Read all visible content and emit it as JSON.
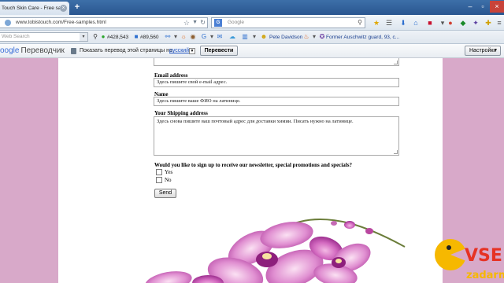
{
  "browser": {
    "tab_title": "Touch Skin Care - Free sam...",
    "new_tab_glyph": "+",
    "url": "www.tobistouch.com/Free-samples.html",
    "search_placeholder": "Google",
    "web_search_placeholder": "Web Search",
    "bookmarks": {
      "counter1": "#428,543",
      "counter2": "#89,560",
      "user": "Pete Davidson",
      "news": "Former Auschwitz guard, 93, c..."
    },
    "icons": [
      "back-icon",
      "forward-icon",
      "globe-icon",
      "star-icon",
      "reload-icon",
      "search-icon",
      "download-icon",
      "home-icon",
      "gear-icon",
      "puzzle-icon"
    ]
  },
  "translate": {
    "logo_google": "oogle",
    "logo_product": "Переводчик",
    "prompt": "Показать перевод этой страницы на",
    "language": "русский",
    "translate_button": "Перевести",
    "settings_button": "Настройки"
  },
  "form": {
    "email_label": "Email address",
    "email_value": "Здесь пишите свой e-mail адрес.",
    "name_label": "Name",
    "name_value": "Здесь пишите ваше ФИО на латинице.",
    "shipping_label": "Your Shipping address",
    "shipping_value": "Здесь снова пишите ваш почтовый адрес для доставки химии. Писать нужно на латинице.",
    "newsletter_question": "Would you like to sign up to receive our newsletter, special promotions and specials?",
    "yes_label": "Yes",
    "no_label": "No",
    "send_button": "Send"
  },
  "watermark": {
    "line1": "VSE",
    "line2": "zadarm"
  },
  "colors": {
    "page_bg": "#d8a9c9",
    "orchid": "#c34fa8",
    "watermark_yellow": "#f6b800",
    "watermark_red": "#e63224"
  }
}
